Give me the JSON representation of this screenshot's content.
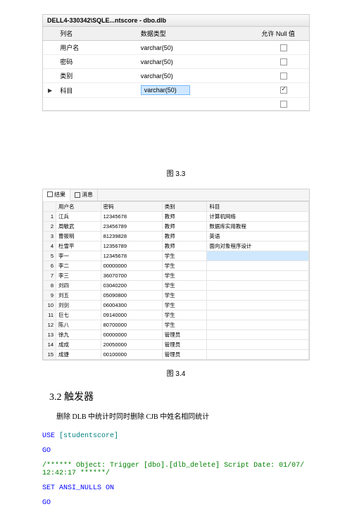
{
  "figure1": {
    "title": "DELL4-330342\\SQLE...ntscore - dbo.dlb",
    "headers": [
      "列名",
      "数据类型",
      "允许 Null 值"
    ],
    "rows": [
      {
        "name": "用户名",
        "type": "varchar(50)",
        "null": false
      },
      {
        "name": "密码",
        "type": "varchar(50)",
        "null": false
      },
      {
        "name": "类别",
        "type": "varchar(50)",
        "null": false
      },
      {
        "name": "科目",
        "type": "varchar(50)",
        "null": true,
        "selected": true,
        "pointer": true
      }
    ],
    "caption": "图 3.3"
  },
  "figure2": {
    "tabs": [
      {
        "label": "结果",
        "icon": "grid-icon",
        "active": true
      },
      {
        "label": "消息",
        "icon": "msg-icon",
        "active": false
      }
    ],
    "headers": [
      "用户名",
      "密码",
      "类别",
      "科目"
    ],
    "rows": [
      {
        "n": 1,
        "u": "江兵",
        "p": "12345678",
        "c": "教师",
        "k": "计算机网络"
      },
      {
        "n": 2,
        "u": "周敏武",
        "p": "23456789",
        "c": "教师",
        "k": "数据库实用教程"
      },
      {
        "n": 3,
        "u": "曹筱明",
        "p": "81239828",
        "c": "教师",
        "k": "英语"
      },
      {
        "n": 4,
        "u": "杜雪平",
        "p": "12356789",
        "c": "教师",
        "k": "面向对象程序设计"
      },
      {
        "n": 5,
        "u": "李一",
        "p": "12345678",
        "c": "学生",
        "k": "",
        "sel": true
      },
      {
        "n": 6,
        "u": "李二",
        "p": "00000000",
        "c": "学生",
        "k": ""
      },
      {
        "n": 7,
        "u": "李三",
        "p": "36070700",
        "c": "学生",
        "k": ""
      },
      {
        "n": 8,
        "u": "刘四",
        "p": "03040200",
        "c": "学生",
        "k": ""
      },
      {
        "n": 9,
        "u": "刘五",
        "p": "05090800",
        "c": "学生",
        "k": ""
      },
      {
        "n": 10,
        "u": "刘剑",
        "p": "06004300",
        "c": "学生",
        "k": ""
      },
      {
        "n": 11,
        "u": "巨七",
        "p": "09140000",
        "c": "学生",
        "k": ""
      },
      {
        "n": 12,
        "u": "陈八",
        "p": "80700000",
        "c": "学生",
        "k": ""
      },
      {
        "n": 13,
        "u": "徐九",
        "p": "00000000",
        "c": "管理员",
        "k": ""
      },
      {
        "n": 14,
        "u": "成成",
        "p": "20050000",
        "c": "管理员",
        "k": ""
      },
      {
        "n": 15,
        "u": "成捷",
        "p": "00100000",
        "c": "管理员",
        "k": ""
      }
    ],
    "caption": "图 3.4"
  },
  "section": {
    "heading": "3.2 触发器",
    "desc": "删除 DLB 中统计时同时删除 CJB 中姓名相同统计"
  },
  "code": {
    "l1_a": "USE ",
    "l1_b": "[studentscore]",
    "l2": "GO",
    "l3_a": "/****** Object:   Trigger ",
    "l3_b": "[dbo].[dlb_delete]",
    "l3_c": "       Script Date: 01/07/ 12:42:17 ******/",
    "l4": "SET ANSI_NULLS ON",
    "l5": "GO"
  }
}
